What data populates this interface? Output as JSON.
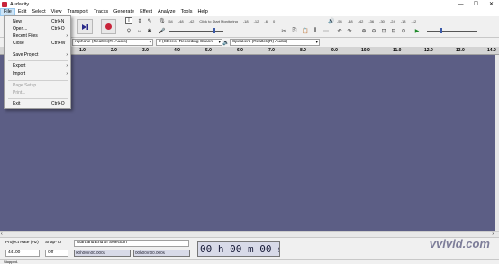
{
  "window": {
    "title": "Audacity",
    "controls": [
      "—",
      "☐",
      "✕"
    ]
  },
  "menubar": {
    "items": [
      "File",
      "Edit",
      "Select",
      "View",
      "Transport",
      "Tracks",
      "Generate",
      "Effect",
      "Analyze",
      "Tools",
      "Help"
    ]
  },
  "file_menu": {
    "items": [
      {
        "label": "New",
        "shortcut": "Ctrl+N"
      },
      {
        "label": "Open...",
        "shortcut": "Ctrl+O"
      },
      {
        "label": "Recent Files",
        "shortcut": "",
        "submenu": "›"
      },
      {
        "label": "Close",
        "shortcut": "Ctrl+W"
      },
      {
        "label": "Save Project",
        "shortcut": "",
        "submenu": "›"
      },
      {
        "label": "Export",
        "shortcut": "",
        "submenu": "›"
      },
      {
        "label": "Import",
        "shortcut": "",
        "submenu": "›"
      },
      {
        "label": "Page Setup...",
        "shortcut": ""
      },
      {
        "label": "Print...",
        "shortcut": ""
      },
      {
        "label": "Exit",
        "shortcut": "Ctrl+Q"
      }
    ]
  },
  "meters": {
    "record_scale": [
      "-54",
      "-48",
      "-42"
    ],
    "record_prompt": "Click to Start Monitoring",
    "record_scale_right": [
      "-18",
      "-12",
      "-6",
      "0"
    ],
    "playback_scale": [
      "-54",
      "-48",
      "-42",
      "-36",
      "-30",
      "-24",
      "-18",
      "-12"
    ]
  },
  "devices": {
    "recording_device": "rophone (Realtek(R) Audio)",
    "channels": "2 (Stereo) Recording Chann",
    "playback_device": "Speakers (Realtek(R) Audio)"
  },
  "ruler": {
    "labels": [
      "1.0",
      "2.0",
      "3.0",
      "4.0",
      "5.0",
      "6.0",
      "7.0",
      "8.0",
      "9.0",
      "10.0",
      "11.0",
      "12.0",
      "13.0",
      "14.0"
    ]
  },
  "selection_toolbar": {
    "project_rate_label": "Project Rate (Hz)",
    "project_rate_value": "44100",
    "snap_to_label": "Snap-To",
    "snap_to_value": "Off",
    "selection_mode": "Start and End of Selection",
    "start_time": "00h00m00.000s",
    "end_time": "00h00m00.000s",
    "audio_position": "00 h 00 m 00 s"
  },
  "status": {
    "text": "Stopped."
  },
  "watermark": {
    "text": "vvivid.com"
  },
  "colors": {
    "track_area": "#5c5e85",
    "record_button": "#c8243a"
  }
}
